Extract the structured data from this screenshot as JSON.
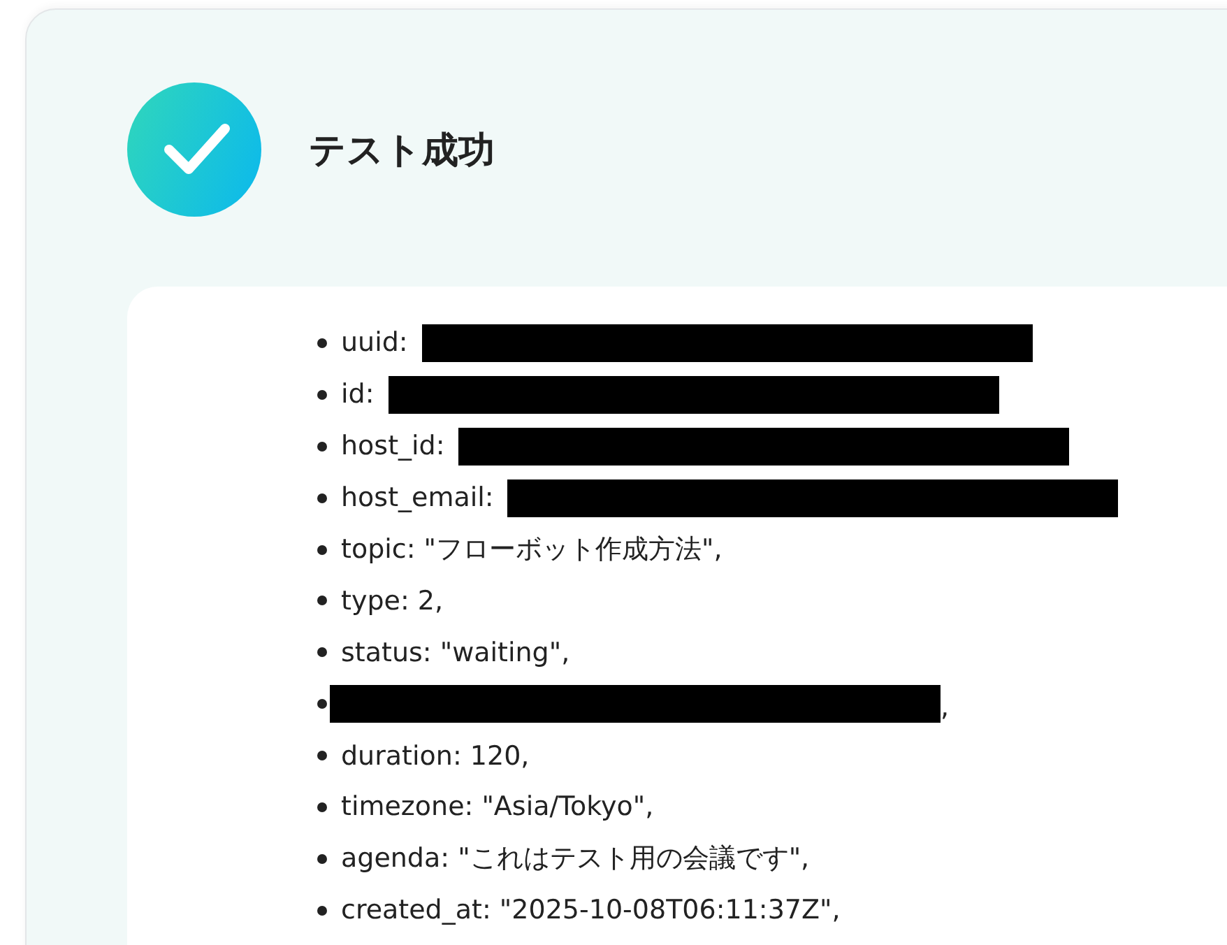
{
  "result": {
    "passed": true,
    "title": "テスト成功"
  },
  "fields": [
    {
      "kind": "redacted",
      "label": "uuid:"
    },
    {
      "kind": "redacted",
      "label": "id:"
    },
    {
      "kind": "redacted",
      "label": "host_id:"
    },
    {
      "kind": "redacted",
      "label": "host_email:"
    },
    {
      "kind": "text",
      "text": "topic: \"フローボット作成方法\","
    },
    {
      "kind": "text",
      "text": "type: 2,"
    },
    {
      "kind": "text",
      "text": "status: \"waiting\","
    },
    {
      "kind": "redacted",
      "suffix": ","
    },
    {
      "kind": "text",
      "text": "duration: 120,"
    },
    {
      "kind": "text",
      "text": "timezone: \"Asia/Tokyo\","
    },
    {
      "kind": "text",
      "text": "agenda: \"これはテスト用の会議です\","
    },
    {
      "kind": "text",
      "text": "created_at: \"2025-10-08T06:11:37Z\","
    }
  ]
}
